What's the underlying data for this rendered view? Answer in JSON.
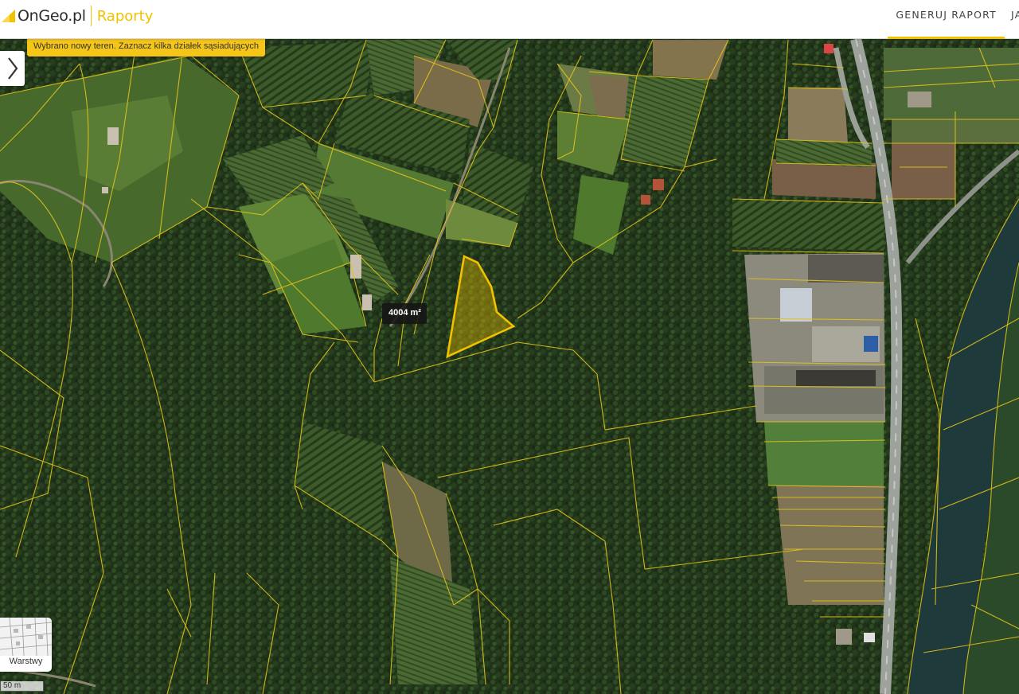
{
  "header": {
    "logo_text": "OnGeo.pl",
    "logo_subtitle": "Raporty",
    "nav": [
      {
        "label": "GENERUJ RAPORT",
        "active": true
      },
      {
        "label": "JA"
      }
    ],
    "accent_color": "#f2c200"
  },
  "map": {
    "notice": "Wybrano nowy teren. Zaznacz kilka działek sąsiadujących",
    "selected_parcel_area": "4004 m²",
    "layers_label": "Warstwy",
    "scale_label": "50 m",
    "panel_toggle_icon": "chevron-right-icon",
    "parcel_line_color": "#e0c21a",
    "selection_color": "#f2c200"
  }
}
